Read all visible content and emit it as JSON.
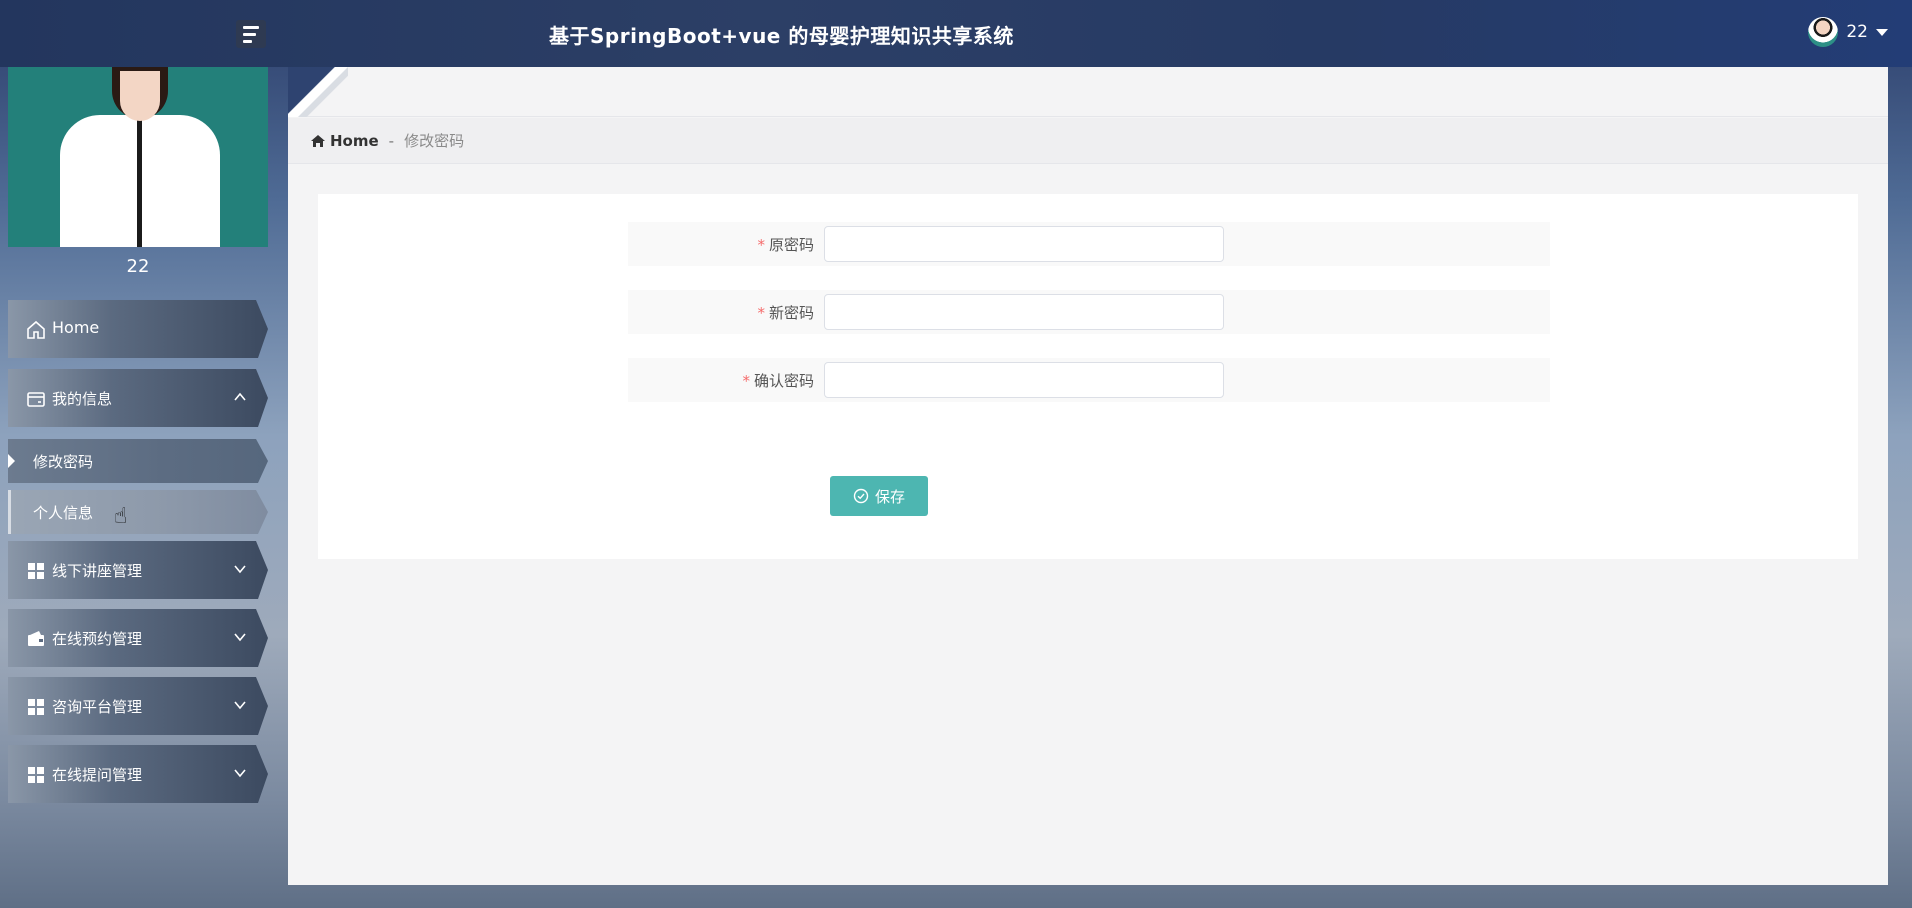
{
  "header": {
    "title": "基于SpringBoot+vue 的母婴护理知识共享系统",
    "user_name": "22"
  },
  "sidebar": {
    "profile_name": "22",
    "items": [
      {
        "label": "Home",
        "icon": "home-icon"
      },
      {
        "label": "我的信息",
        "icon": "wallet-card-icon",
        "expanded": true,
        "children": [
          {
            "label": "修改密码",
            "active": true
          },
          {
            "label": "个人信息",
            "hover": true
          }
        ]
      },
      {
        "label": "线下讲座管理",
        "icon": "grid-icon"
      },
      {
        "label": "在线预约管理",
        "icon": "wallet-icon"
      },
      {
        "label": "咨询平台管理",
        "icon": "grid-icon"
      },
      {
        "label": "在线提问管理",
        "icon": "grid-icon"
      }
    ]
  },
  "breadcrumb": {
    "home": "Home",
    "separator": "-",
    "current": "修改密码"
  },
  "form": {
    "required_mark": "*",
    "fields": [
      {
        "label": "原密码",
        "value": "",
        "placeholder": ""
      },
      {
        "label": "新密码",
        "value": "",
        "placeholder": ""
      },
      {
        "label": "确认密码",
        "value": "",
        "placeholder": ""
      }
    ],
    "save_label": "保存"
  },
  "colors": {
    "accent": "#4db6b1",
    "required": "#f56c6c",
    "header_bg": "#263a64"
  }
}
